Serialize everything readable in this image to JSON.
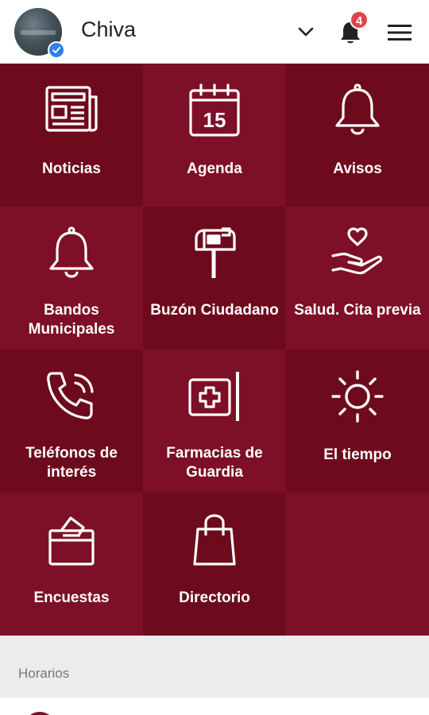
{
  "header": {
    "title": "Chiva",
    "notification_count": "4"
  },
  "tiles": [
    {
      "label": "Noticias",
      "icon": "newspaper-icon"
    },
    {
      "label": "Agenda",
      "icon": "calendar-icon",
      "icon_text": "15"
    },
    {
      "label": "Avisos",
      "icon": "bell-icon"
    },
    {
      "label": "Bandos Municipales",
      "icon": "bell-icon"
    },
    {
      "label": "Buzón Ciudadano",
      "icon": "mailbox-icon"
    },
    {
      "label": "Salud. Cita previa",
      "icon": "heart-hand-icon"
    },
    {
      "label": "Teléfonos de interés",
      "icon": "phone-icon"
    },
    {
      "label": "Farmacias de Guardia",
      "icon": "pharmacy-icon"
    },
    {
      "label": "El tiempo",
      "icon": "sun-icon"
    },
    {
      "label": "Encuestas",
      "icon": "ballot-box-icon"
    },
    {
      "label": "Directorio",
      "icon": "shopping-bag-icon"
    }
  ],
  "section": {
    "title": "Horarios"
  },
  "colors": {
    "tile_dark": "#6d0b1c",
    "tile_light": "#7d1026",
    "badge": "#e0444b",
    "verified": "#2f80ed"
  }
}
